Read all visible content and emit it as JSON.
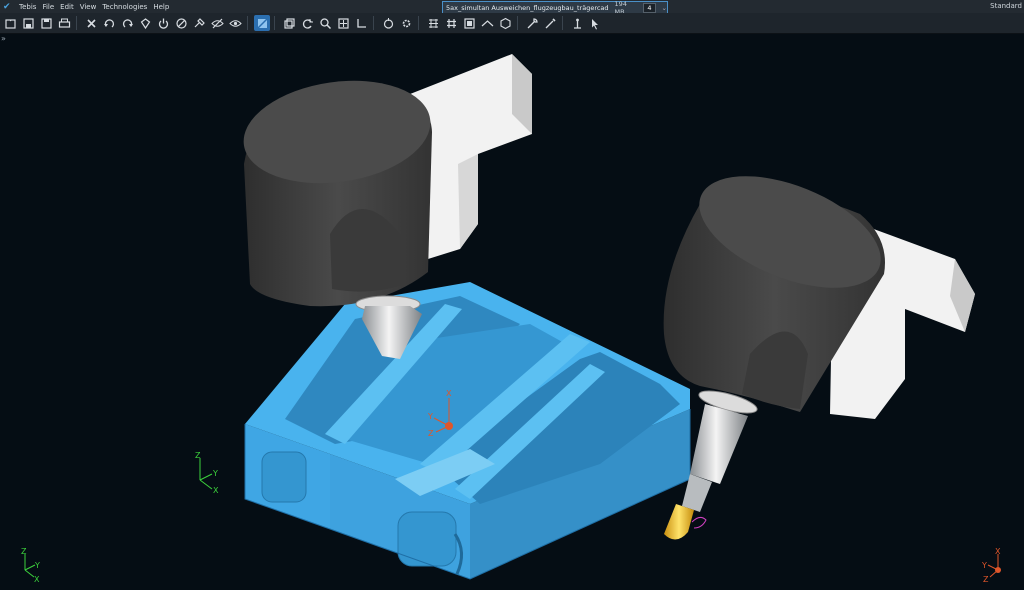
{
  "app": {
    "name": "Tebis"
  },
  "menu": [
    "File",
    "Edit",
    "View",
    "Technologies",
    "Help"
  ],
  "document_tab": {
    "filename": "5ax_simultan Ausweichen_flugzeugbau_trägercad",
    "size": "194 MB",
    "count": "4"
  },
  "layout_label": "Standard",
  "expander_glyph": "»",
  "toolbar": {
    "icons": [
      "new-file-icon",
      "open-file-icon",
      "save-icon",
      "print-icon",
      "delete-icon",
      "undo-icon",
      "redo-icon",
      "recycle-icon",
      "power-icon",
      "no-entry-icon",
      "tool-settings-icon",
      "hide-icon",
      "hide-all-icon",
      "active-view-icon",
      "copy-view-icon",
      "refresh-icon",
      "zoom-icon",
      "zoom-fit-icon",
      "axis-system-icon",
      "rotate-icon",
      "gear-icon",
      "grid-icon",
      "hash-icon",
      "frame-icon",
      "filter-icon",
      "cube-icon",
      "wrench-icon",
      "tool-path-icon",
      "anchor-icon",
      "pointer-icon"
    ]
  },
  "axis_labels": {
    "origin": {
      "x": "X",
      "y": "Y",
      "z": "Z"
    },
    "triad_bottom_left": {
      "x": "X",
      "y": "Y",
      "z": "Z"
    },
    "triad_bottom_right": {
      "x": "X",
      "y": "Y",
      "z": "Z"
    },
    "triad_part": {
      "x": "X",
      "y": "Y",
      "z": "Z"
    }
  },
  "colors": {
    "background": "#050d14",
    "part": "#3ea8e6",
    "part_dark": "#2a86c2",
    "spindle_head": "#3d3d3d",
    "bracket": "#f2f2f2",
    "tool_tip": "#f6c22a",
    "axis_x": "#3cd13c",
    "axis_origin": "#e0562a"
  }
}
